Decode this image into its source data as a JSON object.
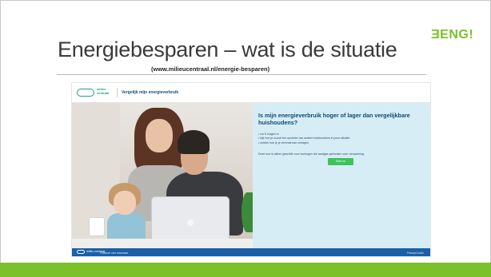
{
  "slide": {
    "title": "Energiebesparen – wat is de situatie",
    "subtitle": "(www.milieucentraal.nl/energie-besparen)",
    "logo_text": "ƎENG!"
  },
  "screenshot": {
    "header": {
      "brand_line1": "milieu",
      "brand_line2": "centraal",
      "link": "Vergelijk mijn energieverbruik"
    },
    "panel": {
      "heading": "Is mijn energieverbruik hoger of lager dan vergelijkbare huishoudens?",
      "bullets": [
        "• vul 5 vragen in",
        "• kijk hoe je scoort ten opzichte van andere huishoudens in jouw situatie",
        "• ontdek hoe je je verbruik kan verlagen"
      ],
      "note": "Deze tool is alleen geschikt voor woningen die aardgas gebruiken voor verwarming.",
      "start_button": "Start nu"
    },
    "footer": {
      "brand": "milieu centraal",
      "tagline": "Praktisch over duurzaam",
      "link": "Privacy/Cookie"
    }
  },
  "colors": {
    "accent_green": "#7cc12a",
    "mc_blue": "#1a5fa8",
    "panel_bg": "#d7edf6"
  }
}
